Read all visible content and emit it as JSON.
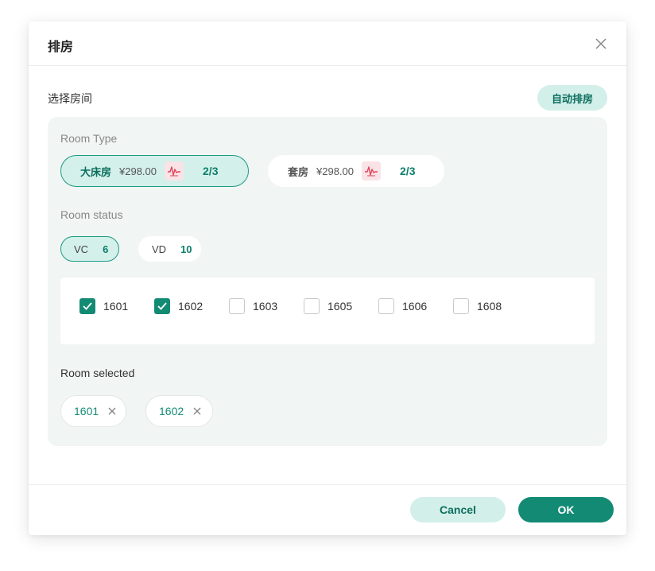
{
  "dialog": {
    "title": "排房",
    "section_label": "选择房间",
    "auto_button": "自动排房"
  },
  "room_type": {
    "label": "Room  Type",
    "items": [
      {
        "name": "大床房",
        "price": "¥298.00",
        "icon": "chart-line-icon",
        "count": "2/3",
        "selected": true
      },
      {
        "name": "套房",
        "price": "¥298.00",
        "icon": "chart-line-icon",
        "count": "2/3",
        "selected": false
      }
    ]
  },
  "room_status": {
    "label": "Room status",
    "items": [
      {
        "name": "VC",
        "count": "6",
        "selected": true
      },
      {
        "name": "VD",
        "count": "10",
        "selected": false
      }
    ]
  },
  "rooms": [
    {
      "number": "1601",
      "checked": true
    },
    {
      "number": "1602",
      "checked": true
    },
    {
      "number": "1603",
      "checked": false
    },
    {
      "number": "1605",
      "checked": false
    },
    {
      "number": "1606",
      "checked": false
    },
    {
      "number": "1608",
      "checked": false
    }
  ],
  "room_selected": {
    "label": "Room selected",
    "chips": [
      "1601",
      "1602"
    ]
  },
  "footer": {
    "cancel_label": "Cancel",
    "ok_label": "OK"
  },
  "colors": {
    "accent": "#128a74",
    "accent_light": "#d4f0ea",
    "panel_bg": "#f1f5f4",
    "icon_bg": "#f9e3e6",
    "icon_stroke": "#e0455c"
  }
}
